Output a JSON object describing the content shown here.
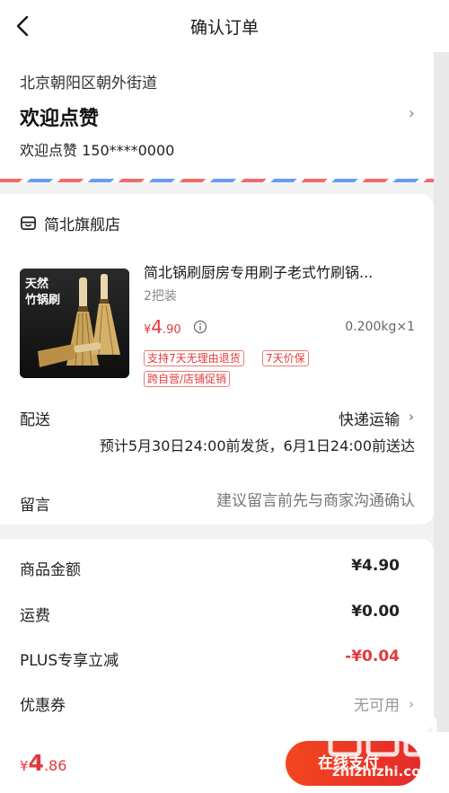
{
  "header": {
    "title": "确认订单"
  },
  "address": {
    "region": "北京朝阳区朝外街道",
    "name": "欢迎点赞",
    "contact": "欢迎点赞 150****0000",
    "chevron": "›"
  },
  "shop": {
    "name": "简北旗舰店"
  },
  "product": {
    "thumb_line1": "天然",
    "thumb_line2": "竹锅刷",
    "title": "简北锅刷厨房专用刷子老式竹刷锅...",
    "spec": "2把装",
    "price_symbol": "¥",
    "price_int": "4",
    "price_dec": ".90",
    "weight": "0.200kg×1",
    "tags": [
      "支持7天无理由退货",
      "7天价保",
      "跨自营/店铺促销"
    ]
  },
  "shipping": {
    "label": "配送",
    "method": "快递运输",
    "chevron": "›",
    "eta": "预计5月30日24:00前发货，6月1日24:00前送达"
  },
  "message": {
    "label": "留言",
    "placeholder": "建议留言前先与商家沟通确认"
  },
  "summary": {
    "goods_label": "商品金额",
    "goods_value": "¥4.90",
    "freight_label": "运费",
    "freight_value": "¥0.00",
    "plus_label": "PLUS专享立减",
    "plus_value": "-¥0.04",
    "coupon_label": "优惠券",
    "coupon_value": "无可用",
    "chevron": "›"
  },
  "footer": {
    "total_symbol": "¥",
    "total_int": "4",
    "total_dec": ".86",
    "pay_label": "在线支付"
  },
  "watermark": {
    "text": "zhizhizhi.com"
  },
  "colors": {
    "accent": "#e4393c",
    "pay_gradient_start": "#f3461f",
    "pay_gradient_end": "#e42b2b",
    "airmail_red": "#f06b6b",
    "airmail_blue": "#6b9cf0"
  }
}
